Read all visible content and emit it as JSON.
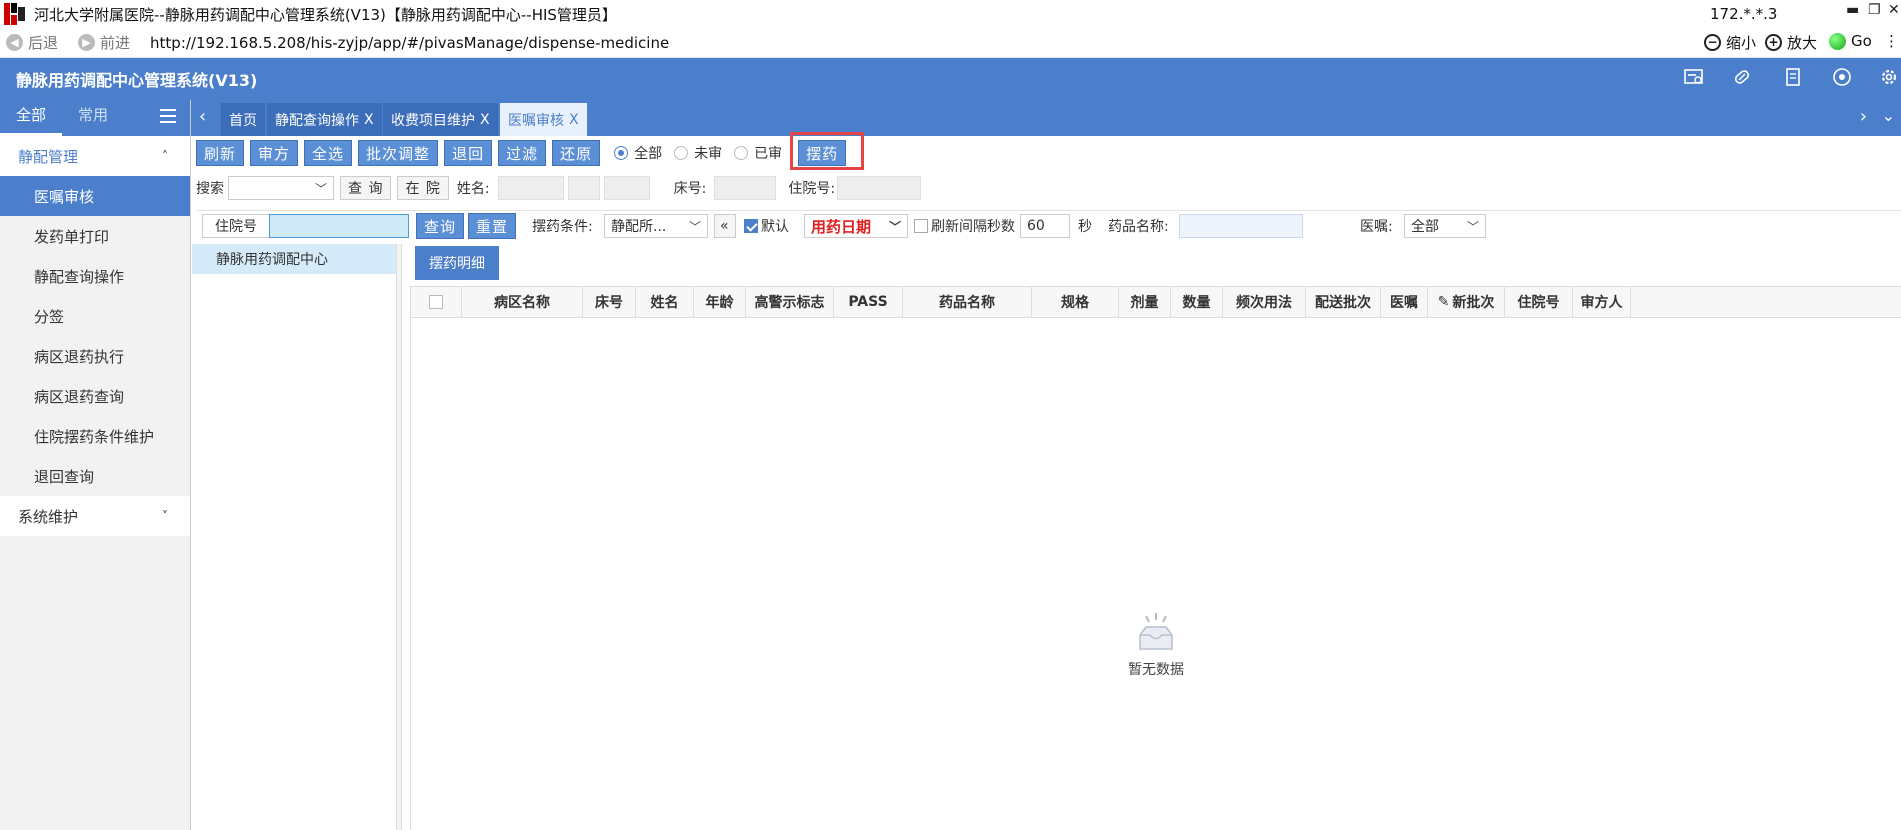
{
  "window": {
    "title": "河北大学附属医院--静脉用药调配中心管理系统(V13)【静脉用药调配中心--HIS管理员】",
    "ip": "172.*.*.3",
    "controls": [
      "▬",
      "❐",
      "✕"
    ]
  },
  "browser": {
    "back_label": "后退",
    "forward_label": "前进",
    "url": "http://192.168.5.208/his-zyjp/app/#/pivasManage/dispense-medicine",
    "zoom_out_label": "缩小",
    "zoom_in_label": "放大",
    "go_label": "Go",
    "more_label": "⋮"
  },
  "app": {
    "title": "静脉用药调配中心管理系统(V13)",
    "header_icons": [
      "card-icon",
      "pill-icon",
      "document-icon",
      "eye-icon",
      "settings-icon"
    ]
  },
  "sidebar": {
    "tabs": [
      "全部",
      "常用"
    ],
    "groups": [
      {
        "label": "静配管理",
        "chevron": "˄",
        "items": [
          "医嘱审核",
          "发药单打印",
          "静配查询操作",
          "分签",
          "病区退药执行",
          "病区退药查询",
          "住院摆药条件维护",
          "退回查询"
        ]
      },
      {
        "label": "系统维护",
        "chevron": "˅",
        "items": []
      }
    ],
    "active_item": "医嘱审核"
  },
  "page_tabs": [
    {
      "label": "首页",
      "closable": false
    },
    {
      "label": "静配查询操作",
      "closable": true
    },
    {
      "label": "收费项目维护",
      "closable": true
    },
    {
      "label": "医嘱审核",
      "closable": true,
      "active": true
    }
  ],
  "tab_close": "X",
  "toolbar": {
    "buttons": [
      "刷新",
      "审方",
      "全选",
      "批次调整",
      "退回",
      "过滤",
      "还原"
    ],
    "radios": [
      {
        "label": "全部",
        "checked": true
      },
      {
        "label": "未审",
        "checked": false
      },
      {
        "label": "已审",
        "checked": false
      }
    ],
    "dispense_button": "摆药"
  },
  "search1": {
    "search_label": "搜索",
    "query_button": "查 询",
    "inpatient_button": "在 院",
    "name_label": "姓名:",
    "bed_label": "床号:",
    "admission_label": "住院号:"
  },
  "search2": {
    "admission_label": "住院号",
    "input_value": "",
    "query_button": "查询",
    "reset_button": "重置",
    "condition_label": "摆药条件:",
    "condition_value": "静配所...",
    "collapse_icon": "«",
    "default_label": "默认",
    "default_checked": true,
    "date_label": "用药日期",
    "refresh_label": "刷新间隔秒数",
    "refresh_checked": false,
    "refresh_value": "60",
    "seconds_label": "秒",
    "drug_name_label": "药品名称:",
    "order_label": "医嘱:",
    "order_value": "全部"
  },
  "tree": {
    "nodes": [
      "静脉用药调配中心"
    ]
  },
  "detail": {
    "tab_label": "摆药明细",
    "columns": [
      "病区名称",
      "床号",
      "姓名",
      "年龄",
      "高警示标志",
      "PASS",
      "药品名称",
      "规格",
      "剂量",
      "数量",
      "频次用法",
      "配送批次",
      "医嘱",
      "新批次",
      "住院号",
      "审方人"
    ],
    "rows": [],
    "empty_text": "暂无数据"
  }
}
